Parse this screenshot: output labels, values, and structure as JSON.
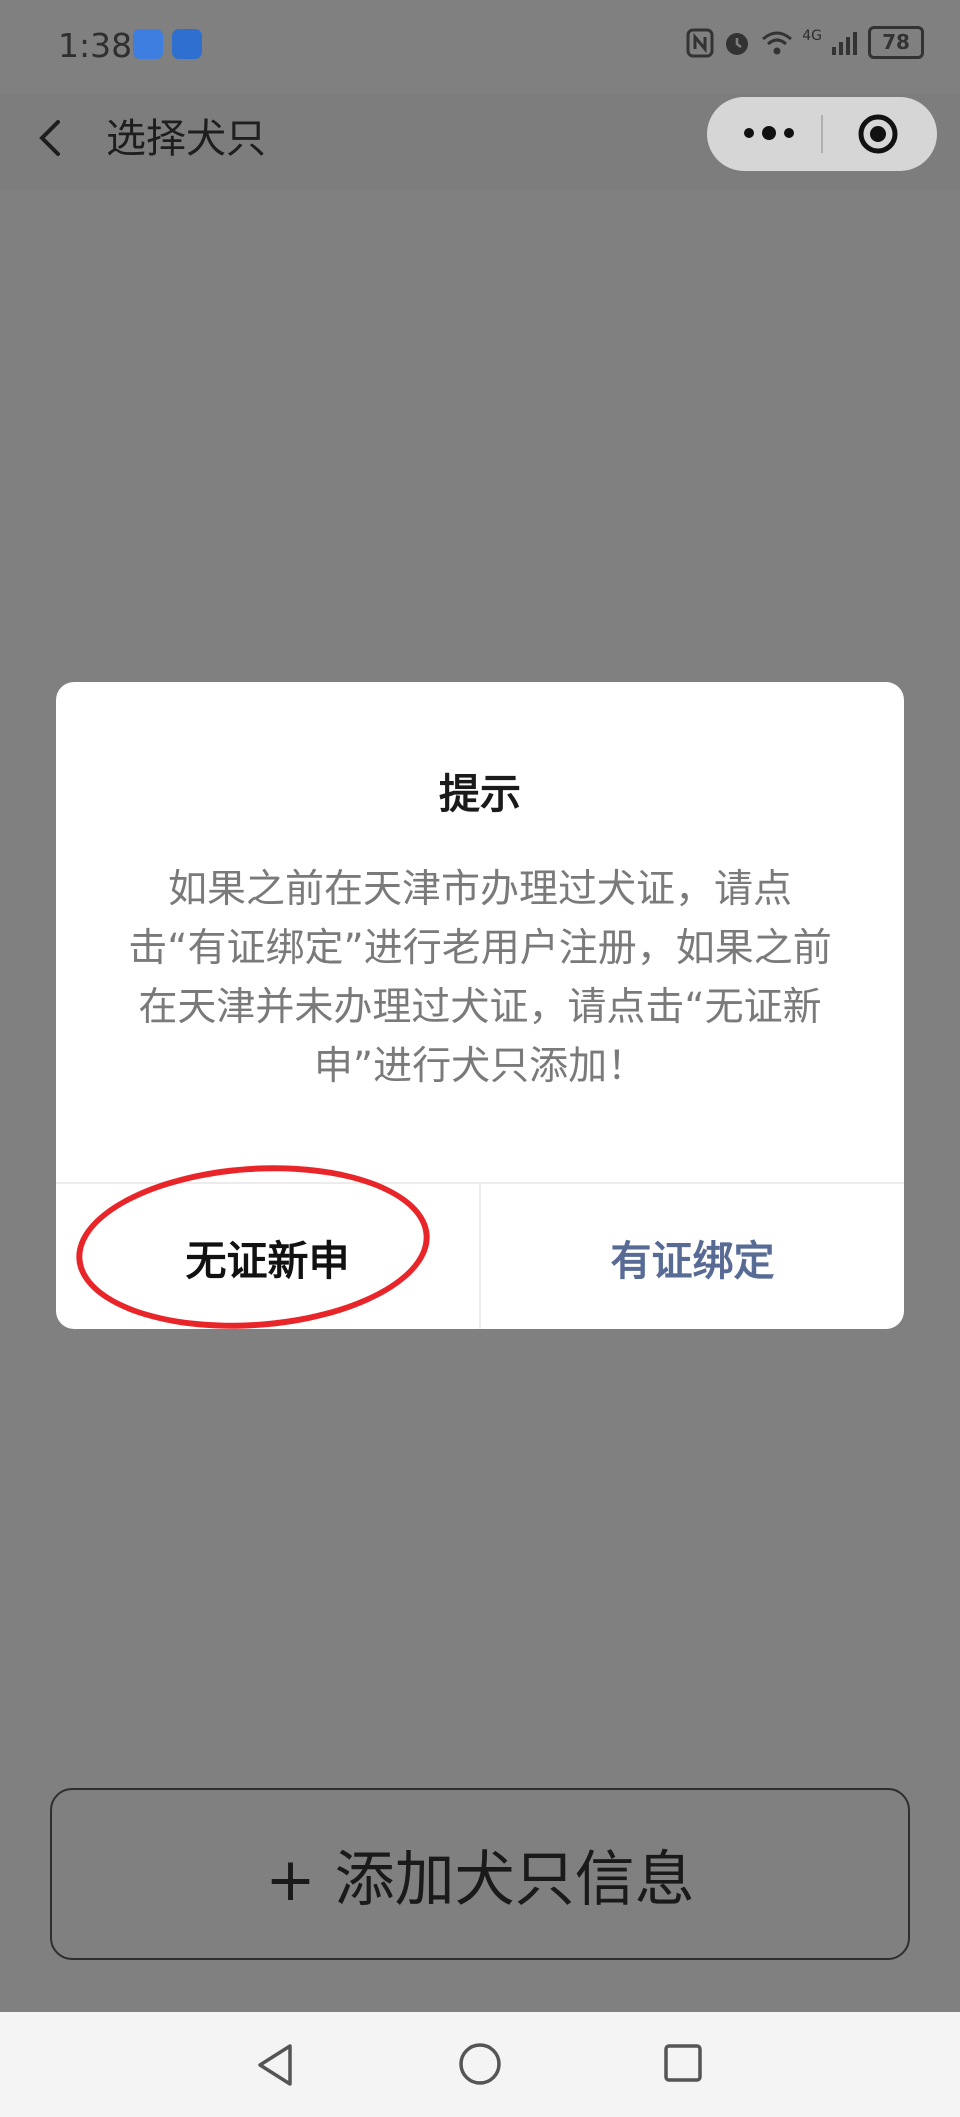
{
  "status_bar": {
    "time": "1:38",
    "battery": "78",
    "icons": [
      "cloud-app-icon",
      "browser-app-icon",
      "nfc-icon",
      "alarm-icon",
      "wifi-icon",
      "signal-4g-icon",
      "battery-icon"
    ],
    "network_label": "4G"
  },
  "nav": {
    "title": "选择犬只",
    "back_icon": "back-arrow-icon",
    "more_icon": "more-dots-icon",
    "close_icon": "target-circle-icon"
  },
  "dialog": {
    "title": "提示",
    "message": "如果之前在天津市办理过犬证，请点击“有证绑定”进行老用户注册，如果之前在天津并未办理过犬证，请点击“无证新申”进行犬只添加！",
    "left_button": "无证新申",
    "right_button": "有证绑定",
    "right_button_color": "#576b95",
    "annotation_color": "#e8262a"
  },
  "main": {
    "add_button": "+ 添加犬只信息"
  },
  "system_nav": {
    "icons": [
      "back-triangle-icon",
      "home-circle-icon",
      "recents-square-icon"
    ]
  }
}
